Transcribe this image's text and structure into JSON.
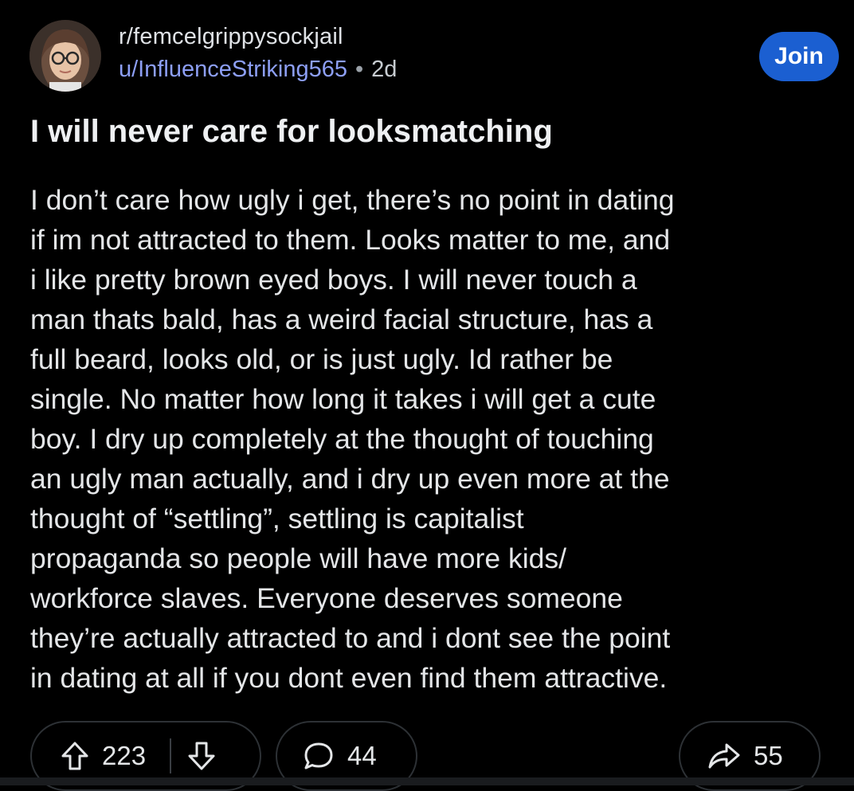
{
  "post": {
    "subreddit": "r/femcelgrippysockjail",
    "username": "u/InfluenceStriking565",
    "separator": "•",
    "age": "2d",
    "join_label": "Join",
    "title": "I will never care for looksmatching",
    "body": "I don’t care how ugly i get, there’s no point in dating\nif im not attracted to them. Looks matter to me, and\ni like pretty brown eyed boys. I will never touch a\nman thats bald, has a weird facial structure, has a\nfull beard, looks old, or is just ugly. Id rather be\nsingle. No matter how long it takes i will get a cute\nboy. I dry up completely at the thought of touching\nan ugly man actually, and i dry up even more at the\nthought of “settling”, settling is capitalist\npropaganda so people will have more kids/\nworkforce slaves. Everyone deserves someone\nthey’re actually attracted to and i dont see the point\nin dating at all if you dont even find them attractive."
  },
  "actions": {
    "upvotes": "223",
    "comments": "44",
    "shares": "55"
  },
  "icons": {
    "upvote": "upvote-arrow-icon",
    "downvote": "downvote-arrow-icon",
    "comment": "comment-bubble-icon",
    "share": "share-arrow-icon"
  },
  "colors": {
    "background": "#000000",
    "username": "#8d9ff5",
    "join_button": "#1b5fd1"
  }
}
